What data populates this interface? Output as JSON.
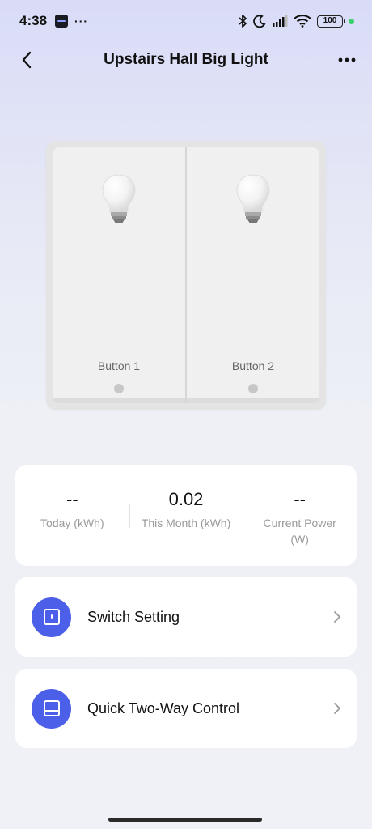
{
  "status_bar": {
    "time": "4:38",
    "overflow": "···",
    "battery": "100",
    "icons": [
      "app-badge-icon",
      "bluetooth-icon",
      "moon-icon",
      "signal-icon",
      "wifi-icon",
      "battery-icon"
    ]
  },
  "header": {
    "title": "Upstairs Hall Big Light",
    "back_icon": "back-arrow-icon",
    "more_icon": "more-dots-icon"
  },
  "switch": {
    "buttons": [
      {
        "label": "Button 1",
        "state": "off"
      },
      {
        "label": "Button 2",
        "state": "off"
      }
    ]
  },
  "energy": {
    "today": {
      "value": "--",
      "label": "Today (kWh)"
    },
    "month": {
      "value": "0.02",
      "label": "This Month (kWh)"
    },
    "power": {
      "value": "--",
      "label": "Current Power (W)"
    }
  },
  "menu": [
    {
      "label": "Switch Setting",
      "icon": "switch-icon"
    },
    {
      "label": "Quick Two-Way Control",
      "icon": "panel-icon"
    }
  ],
  "colors": {
    "accent": "#4c5fe8",
    "background_top": "#d9dcf7",
    "background_bottom": "#f0f1f6",
    "card": "#ffffff"
  }
}
